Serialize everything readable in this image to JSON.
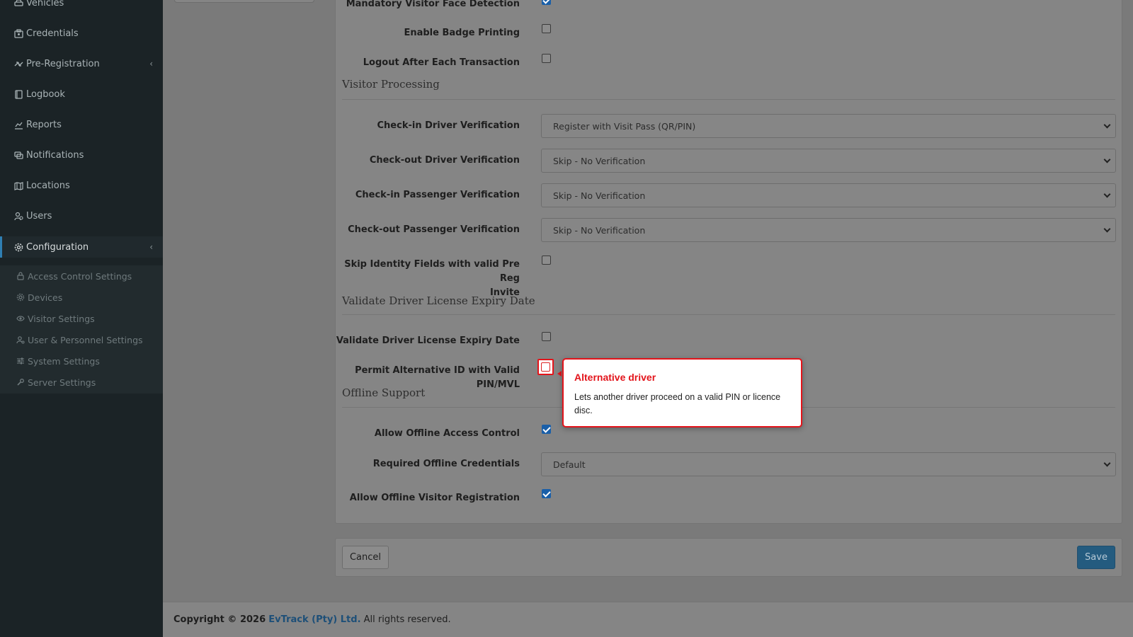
{
  "sidebar": {
    "items": [
      {
        "label": "Vehicles",
        "icon": "car-icon"
      },
      {
        "label": "Credentials",
        "icon": "id-card-icon"
      },
      {
        "label": "Pre-Registration",
        "icon": "arrows-icon",
        "has_children": true
      },
      {
        "label": "Logbook",
        "icon": "book-icon"
      },
      {
        "label": "Reports",
        "icon": "chart-icon"
      },
      {
        "label": "Notifications",
        "icon": "chat-icon"
      },
      {
        "label": "Locations",
        "icon": "map-icon"
      },
      {
        "label": "Users",
        "icon": "users-icon"
      },
      {
        "label": "Configuration",
        "icon": "gear-icon",
        "has_children": true,
        "active": true
      }
    ],
    "sub_items": [
      {
        "label": "Access Control Settings",
        "icon": "lock-icon"
      },
      {
        "label": "Devices",
        "icon": "device-icon"
      },
      {
        "label": "Visitor Settings",
        "icon": "eye-icon"
      },
      {
        "label": "User & Personnel Settings",
        "icon": "user-cog-icon"
      },
      {
        "label": "System Settings",
        "icon": "sliders-icon"
      },
      {
        "label": "Server Settings",
        "icon": "wrench-icon"
      }
    ]
  },
  "form": {
    "top_fields": [
      {
        "label": "Mandatory Visitor Face Detection",
        "checked": true
      },
      {
        "label": "Enable Badge Printing",
        "checked": false
      },
      {
        "label": "Logout After Each Transaction",
        "checked": false
      }
    ],
    "visitor_processing": {
      "title": "Visitor Processing",
      "selects": [
        {
          "label": "Check-in Driver Verification",
          "value": "Register with Visit Pass (QR/PIN)"
        },
        {
          "label": "Check-out Driver Verification",
          "value": "Skip - No Verification"
        },
        {
          "label": "Check-in Passenger Verification",
          "value": "Skip - No Verification"
        },
        {
          "label": "Check-out Passenger Verification",
          "value": "Skip - No Verification"
        }
      ],
      "skip_identity": {
        "label_line1": "Skip Identity Fields with valid Pre Reg",
        "label_line2": "Invite",
        "checked": false
      }
    },
    "license": {
      "title": "Validate Driver License Expiry Date",
      "validate": {
        "label": "Validate Driver License Expiry Date",
        "checked": false
      },
      "permit_alt": {
        "label": "Permit Alternative ID with Valid PIN/MVL",
        "checked": false
      }
    },
    "offline": {
      "title": "Offline Support",
      "allow_access": {
        "label": "Allow Offline Access Control",
        "checked": true
      },
      "required_credentials": {
        "label": "Required Offline Credentials",
        "value": "Default"
      },
      "allow_registration": {
        "label": "Allow Offline Visitor Registration",
        "checked": true
      }
    }
  },
  "tooltip": {
    "title": "Alternative driver",
    "body": "Lets another driver proceed on a valid PIN or licence disc.",
    "color": "#e3141b"
  },
  "buttons": {
    "cancel": "Cancel",
    "save": "Save"
  },
  "footer": {
    "prefix": "Copyright © 2026",
    "company": "EvTrack (Pty) Ltd.",
    "suffix": "All rights reserved."
  },
  "colors": {
    "sidebar_bg": "#1b2326",
    "accent": "#2f7fb3",
    "save_button": "#245b7f",
    "checkbox_on": "#1a5fa8"
  }
}
